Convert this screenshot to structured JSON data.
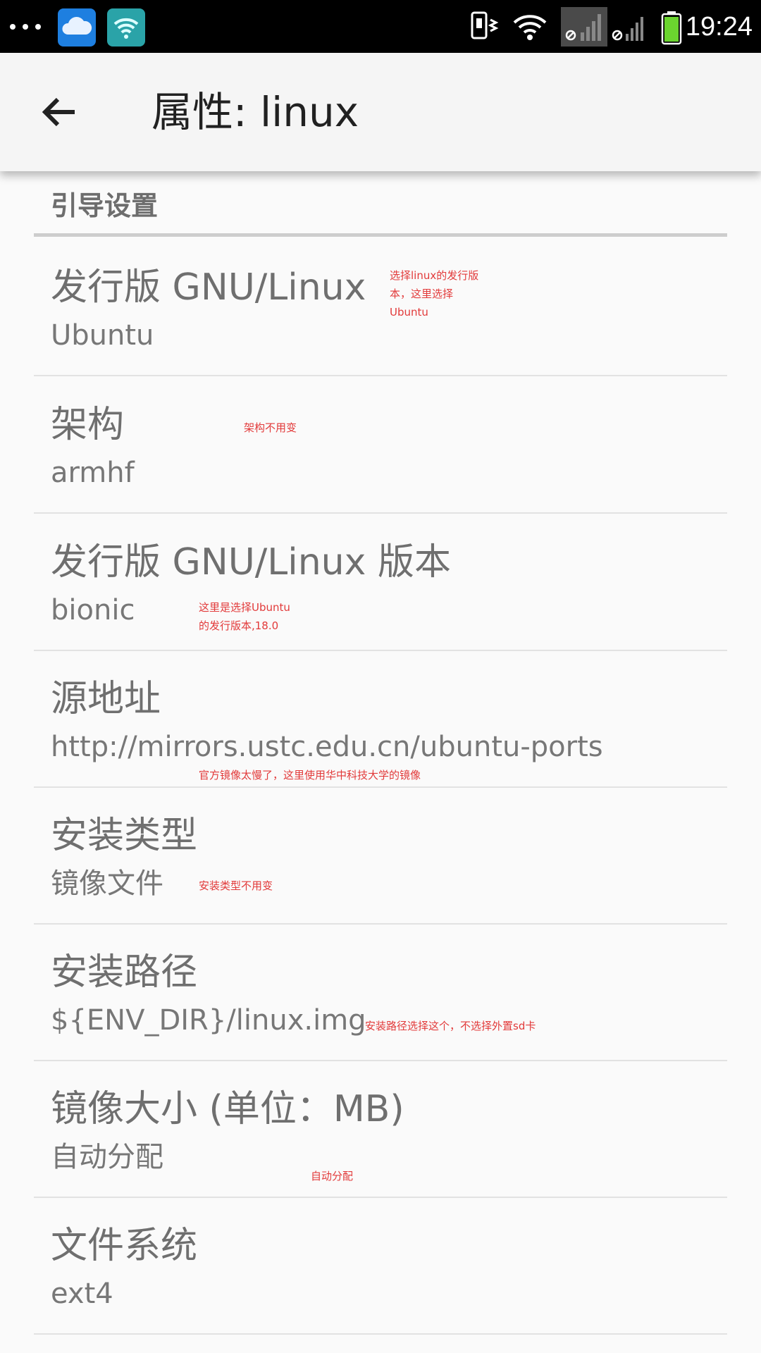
{
  "status_bar": {
    "time": "19:24",
    "icons": [
      "more-dots-icon",
      "cloud-app-icon",
      "wifi-app-icon",
      "phone-vibrate-icon",
      "wifi-signal-icon",
      "cell-signal-1-icon",
      "cell-signal-2-icon",
      "battery-icon"
    ]
  },
  "toolbar": {
    "back_icon": "arrow-back-icon",
    "title": "属性: linux"
  },
  "section": {
    "title": "引导设置"
  },
  "preferences": [
    {
      "title": "发行版 GNU/Linux",
      "summary": "Ubuntu"
    },
    {
      "title": "架构",
      "summary": "armhf"
    },
    {
      "title": "发行版 GNU/Linux 版本",
      "summary": "bionic"
    },
    {
      "title": "源地址",
      "summary": "http://mirrors.ustc.edu.cn/ubuntu-ports"
    },
    {
      "title": "安装类型",
      "summary": "镜像文件"
    },
    {
      "title": "安装路径",
      "summary": "${ENV_DIR}/linux.img"
    },
    {
      "title": "镜像大小 (单位：MB)",
      "summary": "自动分配"
    },
    {
      "title": "文件系统",
      "summary": "ext4"
    }
  ],
  "annotations": {
    "distro": [
      "选择linux的发行版",
      "本，这里选择",
      "Ubuntu"
    ],
    "arch": "架构不用变",
    "version": [
      "这里是选择Ubuntu",
      "的发行版本,18.0"
    ],
    "source": "官方镜像太慢了，这里使用华中科技大学的镜像",
    "install_type": "安装类型不用变",
    "install_path": "安装路径选择这个，不选择外置sd卡",
    "image_size": "自动分配"
  },
  "colors": {
    "annotation_red": "#e23a3a",
    "toolbar_bg": "#f5f5f5",
    "page_bg": "#fafafa"
  }
}
